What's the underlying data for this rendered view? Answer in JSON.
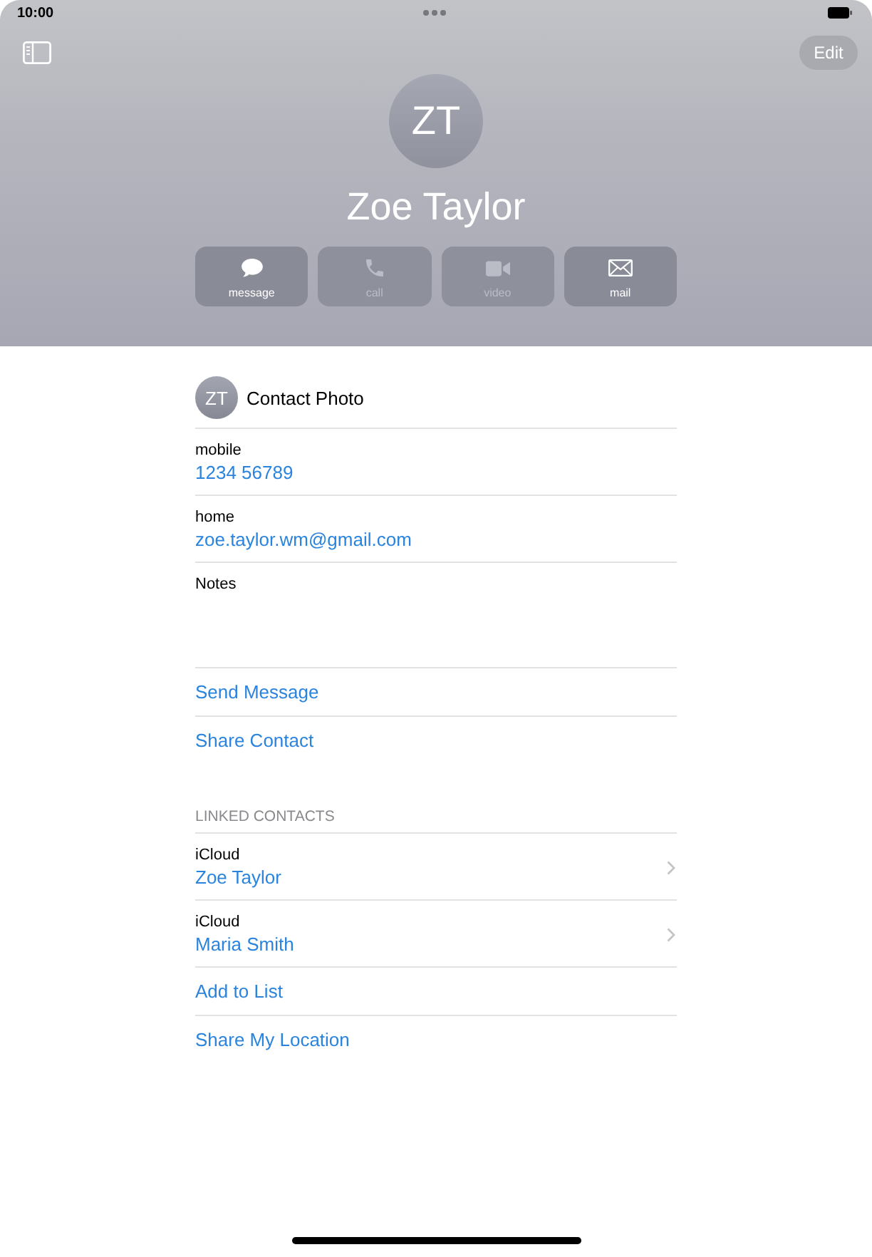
{
  "status_bar": {
    "time": "10:00"
  },
  "toolbar": {
    "edit_button": "Edit"
  },
  "contact": {
    "initials": "ZT",
    "name": "Zoe Taylor"
  },
  "actions": [
    {
      "kind": "message",
      "label": "message",
      "disabled": false
    },
    {
      "kind": "call",
      "label": "call",
      "disabled": true
    },
    {
      "kind": "video",
      "label": "video",
      "disabled": true
    },
    {
      "kind": "mail",
      "label": "mail",
      "disabled": false
    }
  ],
  "photo_row": {
    "initials": "ZT",
    "label": "Contact Photo"
  },
  "fields": [
    {
      "label": "mobile",
      "value": "1234 56789"
    },
    {
      "label": "home",
      "value": "zoe.taylor.wm@gmail.com"
    }
  ],
  "notes": {
    "label": "Notes"
  },
  "links": [
    "Send Message",
    "Share Contact"
  ],
  "linked_contacts": {
    "header": "LINKED CONTACTS",
    "items": [
      {
        "source": "iCloud",
        "name": "Zoe Taylor"
      },
      {
        "source": "iCloud",
        "name": "Maria Smith"
      }
    ]
  },
  "more_links": [
    "Add to List",
    "Share My Location"
  ]
}
